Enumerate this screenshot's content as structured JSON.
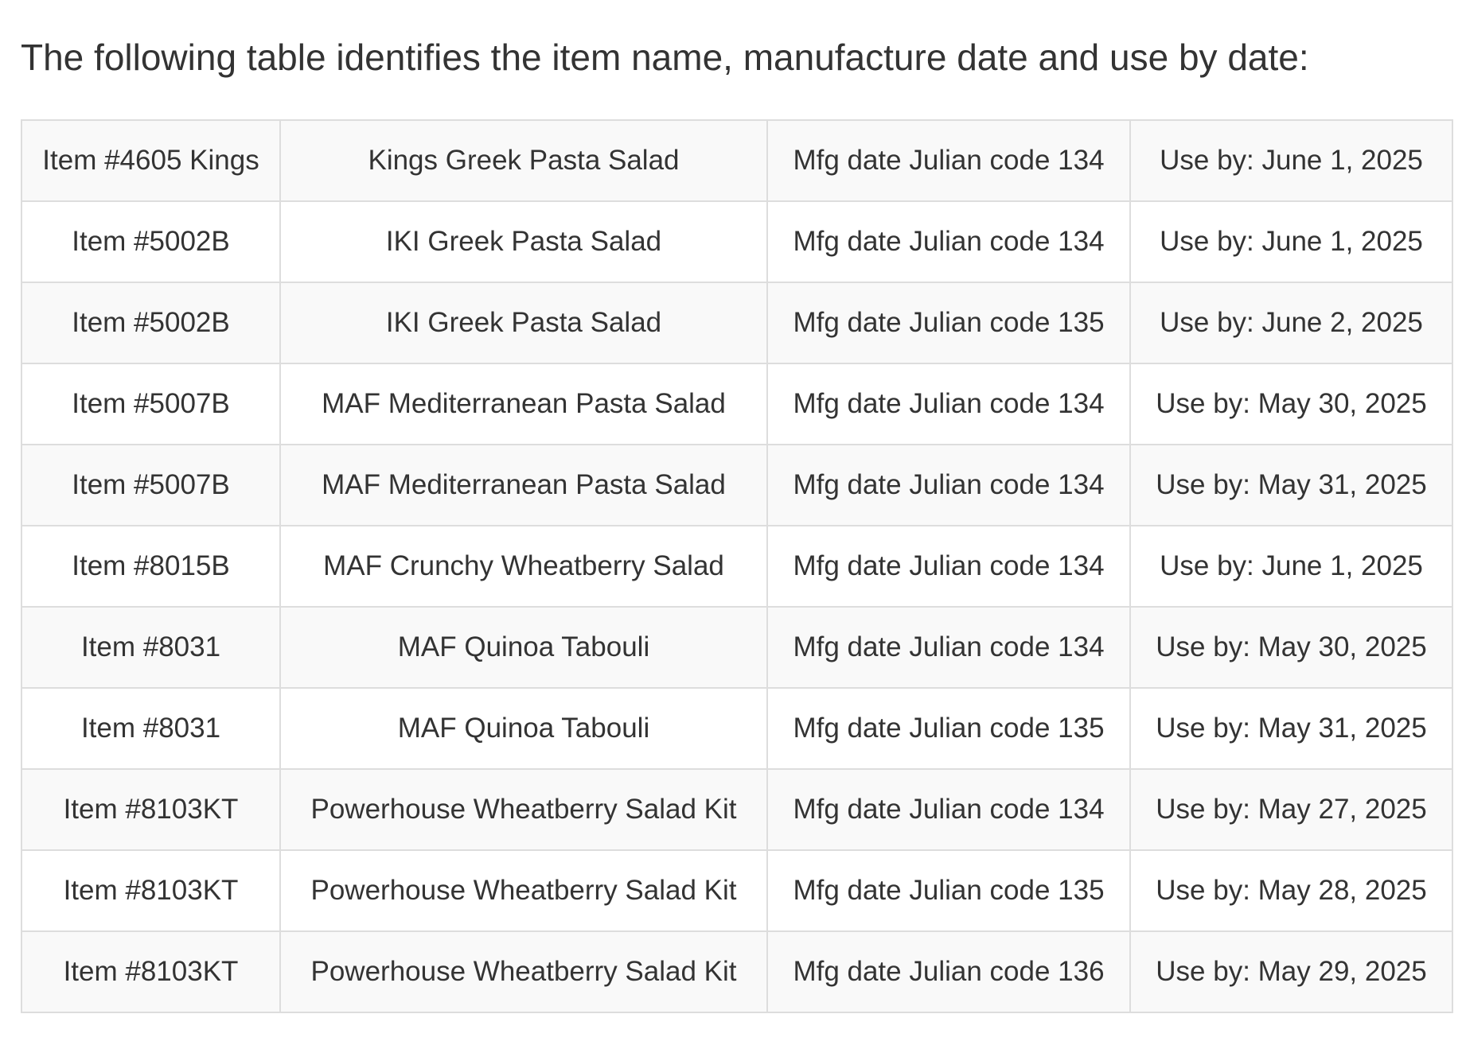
{
  "intro_text": "The following table identifies the item name, manufacture date and use by date:",
  "table": {
    "rows": [
      {
        "item": "Item #4605 Kings",
        "name": "Kings Greek Pasta Salad",
        "mfg": "Mfg date Julian code 134",
        "use_by": "Use by: June 1, 2025"
      },
      {
        "item": "Item #5002B",
        "name": "IKI Greek Pasta Salad",
        "mfg": "Mfg date Julian code 134",
        "use_by": "Use by: June 1, 2025"
      },
      {
        "item": "Item #5002B",
        "name": "IKI Greek Pasta Salad",
        "mfg": "Mfg date Julian code 135",
        "use_by": "Use by: June 2, 2025"
      },
      {
        "item": "Item #5007B",
        "name": "MAF Mediterranean Pasta Salad",
        "mfg": "Mfg date Julian code 134",
        "use_by": "Use by: May 30, 2025"
      },
      {
        "item": "Item #5007B",
        "name": "MAF Mediterranean Pasta Salad",
        "mfg": "Mfg date Julian code 134",
        "use_by": "Use by: May 31, 2025"
      },
      {
        "item": "Item #8015B",
        "name": "MAF Crunchy Wheatberry Salad",
        "mfg": "Mfg date Julian code 134",
        "use_by": "Use by: June 1, 2025"
      },
      {
        "item": "Item #8031",
        "name": "MAF Quinoa Tabouli",
        "mfg": "Mfg date Julian code 134",
        "use_by": "Use by: May 30, 2025"
      },
      {
        "item": "Item #8031",
        "name": "MAF Quinoa Tabouli",
        "mfg": "Mfg date Julian code 135",
        "use_by": "Use by: May 31, 2025"
      },
      {
        "item": "Item #8103KT",
        "name": "Powerhouse Wheatberry Salad Kit",
        "mfg": "Mfg date Julian code 134",
        "use_by": "Use by: May 27, 2025"
      },
      {
        "item": "Item #8103KT",
        "name": "Powerhouse Wheatberry Salad Kit",
        "mfg": "Mfg date Julian code 135",
        "use_by": "Use by: May 28, 2025"
      },
      {
        "item": "Item #8103KT",
        "name": "Powerhouse Wheatberry Salad Kit",
        "mfg": "Mfg date Julian code 136",
        "use_by": "Use by: May 29, 2025"
      }
    ]
  }
}
